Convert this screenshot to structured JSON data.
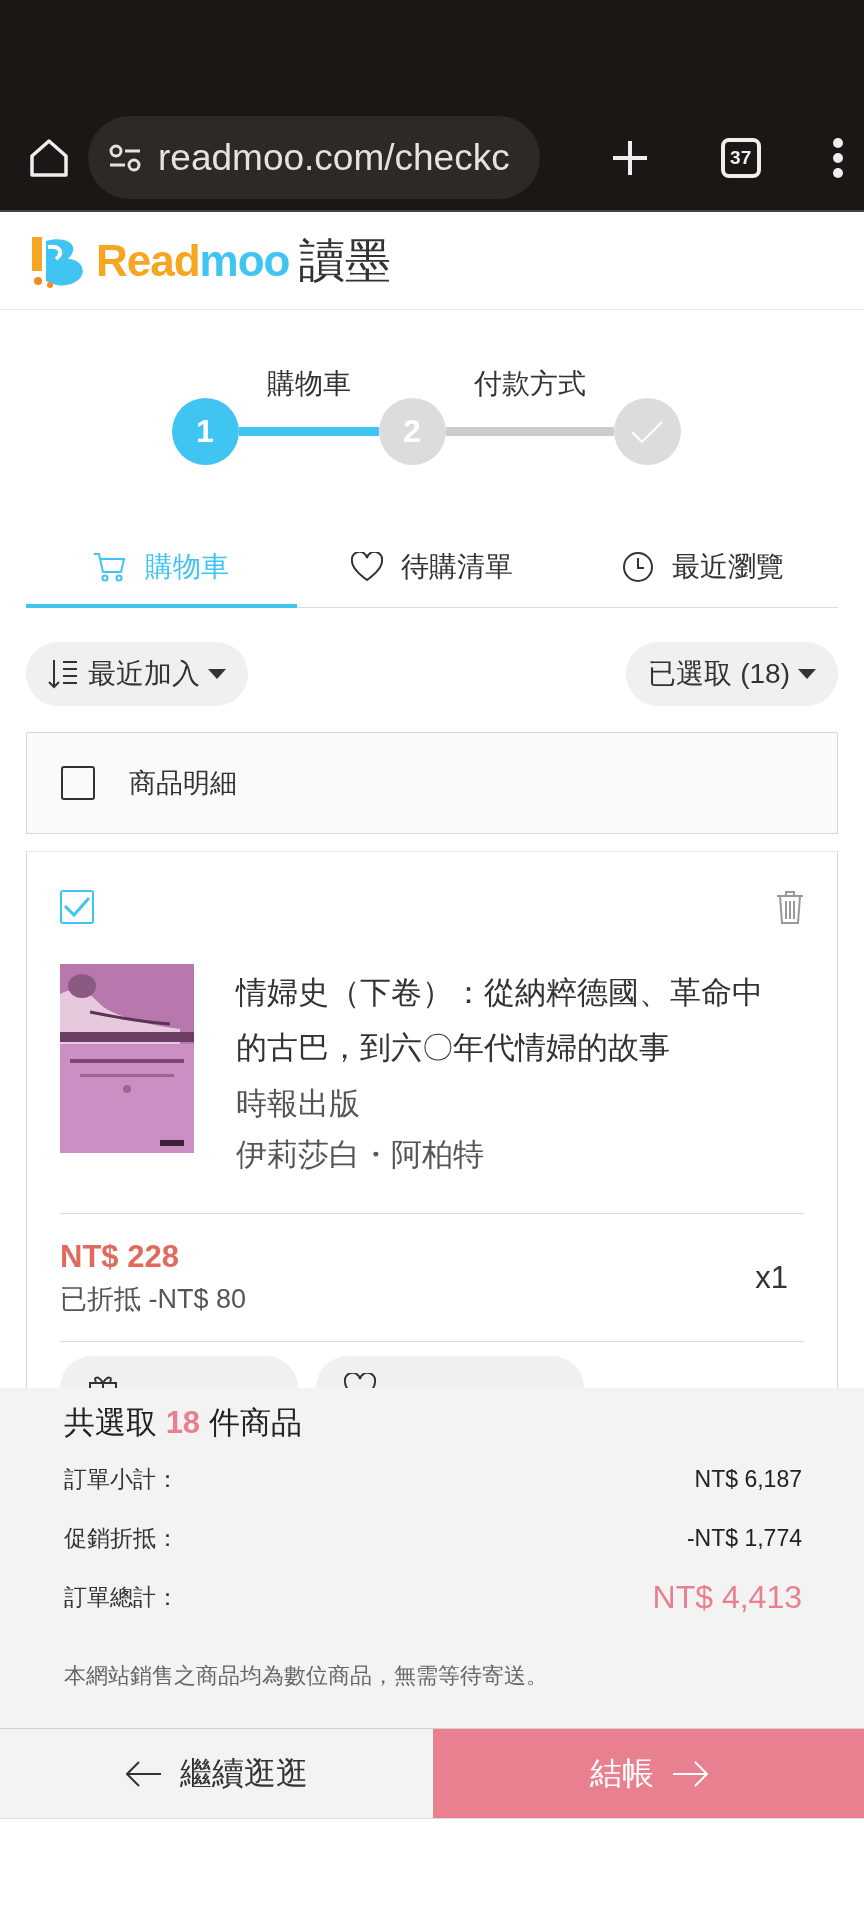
{
  "browser": {
    "url": "readmoo.com/checkc",
    "tab_count": "37"
  },
  "logo": {
    "wordmark_a": "Read",
    "wordmark_b": "moo",
    "chinese": "讀墨"
  },
  "steps": [
    {
      "kind": "number",
      "number": "1",
      "done": true
    },
    {
      "kind": "number",
      "number": "2",
      "done": false
    },
    {
      "kind": "check",
      "done": false
    }
  ],
  "step_segments": [
    {
      "label": "購物車",
      "filled": true
    },
    {
      "label": "付款方式",
      "filled": false
    }
  ],
  "tabs": [
    {
      "kind": "cart",
      "label": "購物車",
      "selected": true
    },
    {
      "kind": "heart",
      "label": "待購清單",
      "selected": false
    },
    {
      "kind": "clock",
      "label": "最近瀏覽",
      "selected": false
    }
  ],
  "sort": {
    "label": "最近加入"
  },
  "selection_filter": {
    "label": "已選取 (18)"
  },
  "list_header": {
    "label": "商品明細",
    "checked": false
  },
  "items": [
    {
      "checked": true,
      "cover": {
        "kind": "picture"
      },
      "title": "情婦史（下卷）：從納粹德國、革命中的古巴，到六〇年代情婦的故事",
      "publisher": "時報出版",
      "author": "伊莉莎白・阿柏特",
      "price": "NT$ 228",
      "discount": "已折抵 -NT$ 80",
      "quantity": "x1",
      "actions": [
        {
          "kind": "gift"
        },
        {
          "kind": "heart"
        }
      ]
    }
  ],
  "summary": {
    "count_prefix": "共選取",
    "count": "18",
    "count_suffix": "件商品",
    "rows": [
      {
        "kind": "plain",
        "label": "訂單小計：",
        "value": "NT$ 6,187"
      },
      {
        "kind": "plain",
        "label": "促銷折抵：",
        "value": "-NT$ 1,774"
      },
      {
        "kind": "total",
        "label": "訂單總計：",
        "value": "NT$ 4,413"
      }
    ],
    "note": "本網站銷售之商品均為數位商品，無需等待寄送。"
  },
  "footer": {
    "back": "繼續逛逛",
    "checkout": "結帳"
  }
}
